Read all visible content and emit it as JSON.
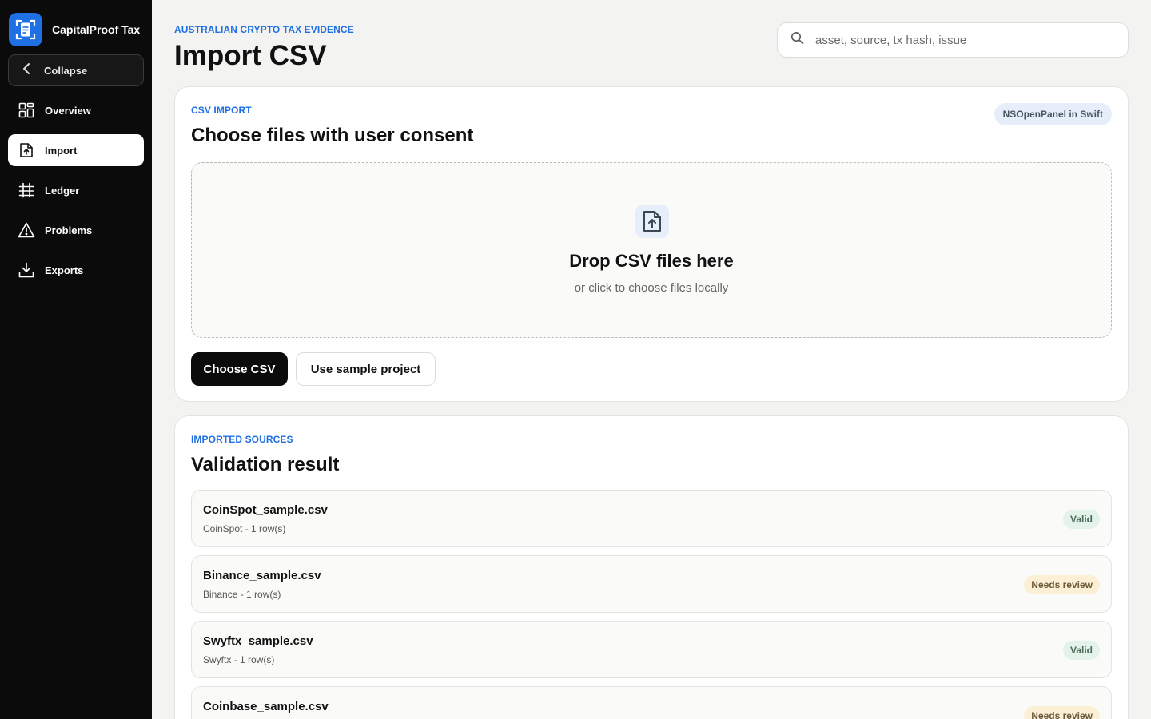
{
  "app": {
    "name": "CapitalProof Tax",
    "accent": "#1f6fe5"
  },
  "sidebar": {
    "collapse_label": "Collapse",
    "items": [
      {
        "label": "Overview",
        "icon": "grid-icon",
        "active": false
      },
      {
        "label": "Import",
        "icon": "file-upload-icon",
        "active": true
      },
      {
        "label": "Ledger",
        "icon": "table-icon",
        "active": false
      },
      {
        "label": "Problems",
        "icon": "warning-icon",
        "active": false
      },
      {
        "label": "Exports",
        "icon": "download-icon",
        "active": false
      }
    ]
  },
  "header": {
    "eyebrow": "AUSTRALIAN CRYPTO TAX EVIDENCE",
    "title": "Import CSV",
    "search_placeholder": "asset, source, tx hash, issue"
  },
  "import_card": {
    "eyebrow": "CSV IMPORT",
    "title": "Choose files with user consent",
    "badge": "NSOpenPanel in Swift",
    "dropzone_title": "Drop CSV files here",
    "dropzone_subtitle": "or click to choose files locally",
    "primary_button": "Choose CSV",
    "secondary_button": "Use sample project"
  },
  "sources_card": {
    "eyebrow": "IMPORTED SOURCES",
    "title": "Validation result",
    "rows": [
      {
        "file": "CoinSpot_sample.csv",
        "meta": "CoinSpot - 1 row(s)",
        "status": "Valid"
      },
      {
        "file": "Binance_sample.csv",
        "meta": "Binance - 1 row(s)",
        "status": "Needs review"
      },
      {
        "file": "Swyftx_sample.csv",
        "meta": "Swyftx - 1 row(s)",
        "status": "Valid"
      },
      {
        "file": "Coinbase_sample.csv",
        "meta": "",
        "status": "Needs review"
      }
    ]
  }
}
